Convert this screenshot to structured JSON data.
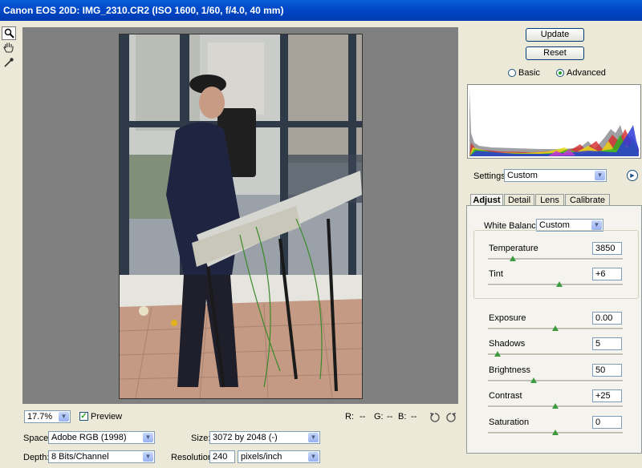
{
  "window": {
    "title": "Canon EOS 20D:  IMG_2310.CR2  (ISO 1600, 1/60, f/4.0, 40 mm)"
  },
  "tools": [
    {
      "name": "zoom-tool-icon"
    },
    {
      "name": "hand-tool-icon"
    },
    {
      "name": "eyedropper-tool-icon"
    }
  ],
  "buttons": {
    "update": "Update",
    "reset": "Reset"
  },
  "mode": {
    "basic": "Basic",
    "advanced": "Advanced",
    "selected": "advanced"
  },
  "settings": {
    "label": "Settings:",
    "value": "Custom"
  },
  "tabs": [
    "Adjust",
    "Detail",
    "Lens",
    "Calibrate"
  ],
  "adjust": {
    "white_balance_label": "White Balance:",
    "white_balance_value": "Custom",
    "temperature": {
      "label": "Temperature",
      "value": "3850",
      "level": 0.17
    },
    "tint": {
      "label": "Tint",
      "value": "+6",
      "level": 0.53
    },
    "exposure": {
      "label": "Exposure",
      "value": "0.00",
      "level": 0.5
    },
    "shadows": {
      "label": "Shadows",
      "value": "5",
      "level": 0.05
    },
    "brightness": {
      "label": "Brightness",
      "value": "50",
      "level": 0.33
    },
    "contrast": {
      "label": "Contrast",
      "value": "+25",
      "level": 0.5
    },
    "saturation": {
      "label": "Saturation",
      "value": "0",
      "level": 0.5
    }
  },
  "preview": {
    "zoom": "17.7%",
    "preview_label": "Preview",
    "preview_checked": true,
    "r_label": "R:",
    "r_value": "--",
    "g_label": "G:",
    "g_value": "--",
    "b_label": "B:",
    "b_value": "--"
  },
  "output": {
    "space_label": "Space:",
    "space_value": "Adobe RGB (1998)",
    "depth_label": "Depth:",
    "depth_value": "8 Bits/Channel",
    "size_label": "Size:",
    "size_value": "3072 by 2048  (-)",
    "resolution_label": "Resolution:",
    "resolution_value": "240",
    "resolution_unit": "pixels/inch"
  },
  "colors": {
    "title_bar": "#0049c9",
    "panel_bg": "#ece9d8",
    "preview_bg": "#808080",
    "slider_thumb": "#3c9a3c"
  }
}
